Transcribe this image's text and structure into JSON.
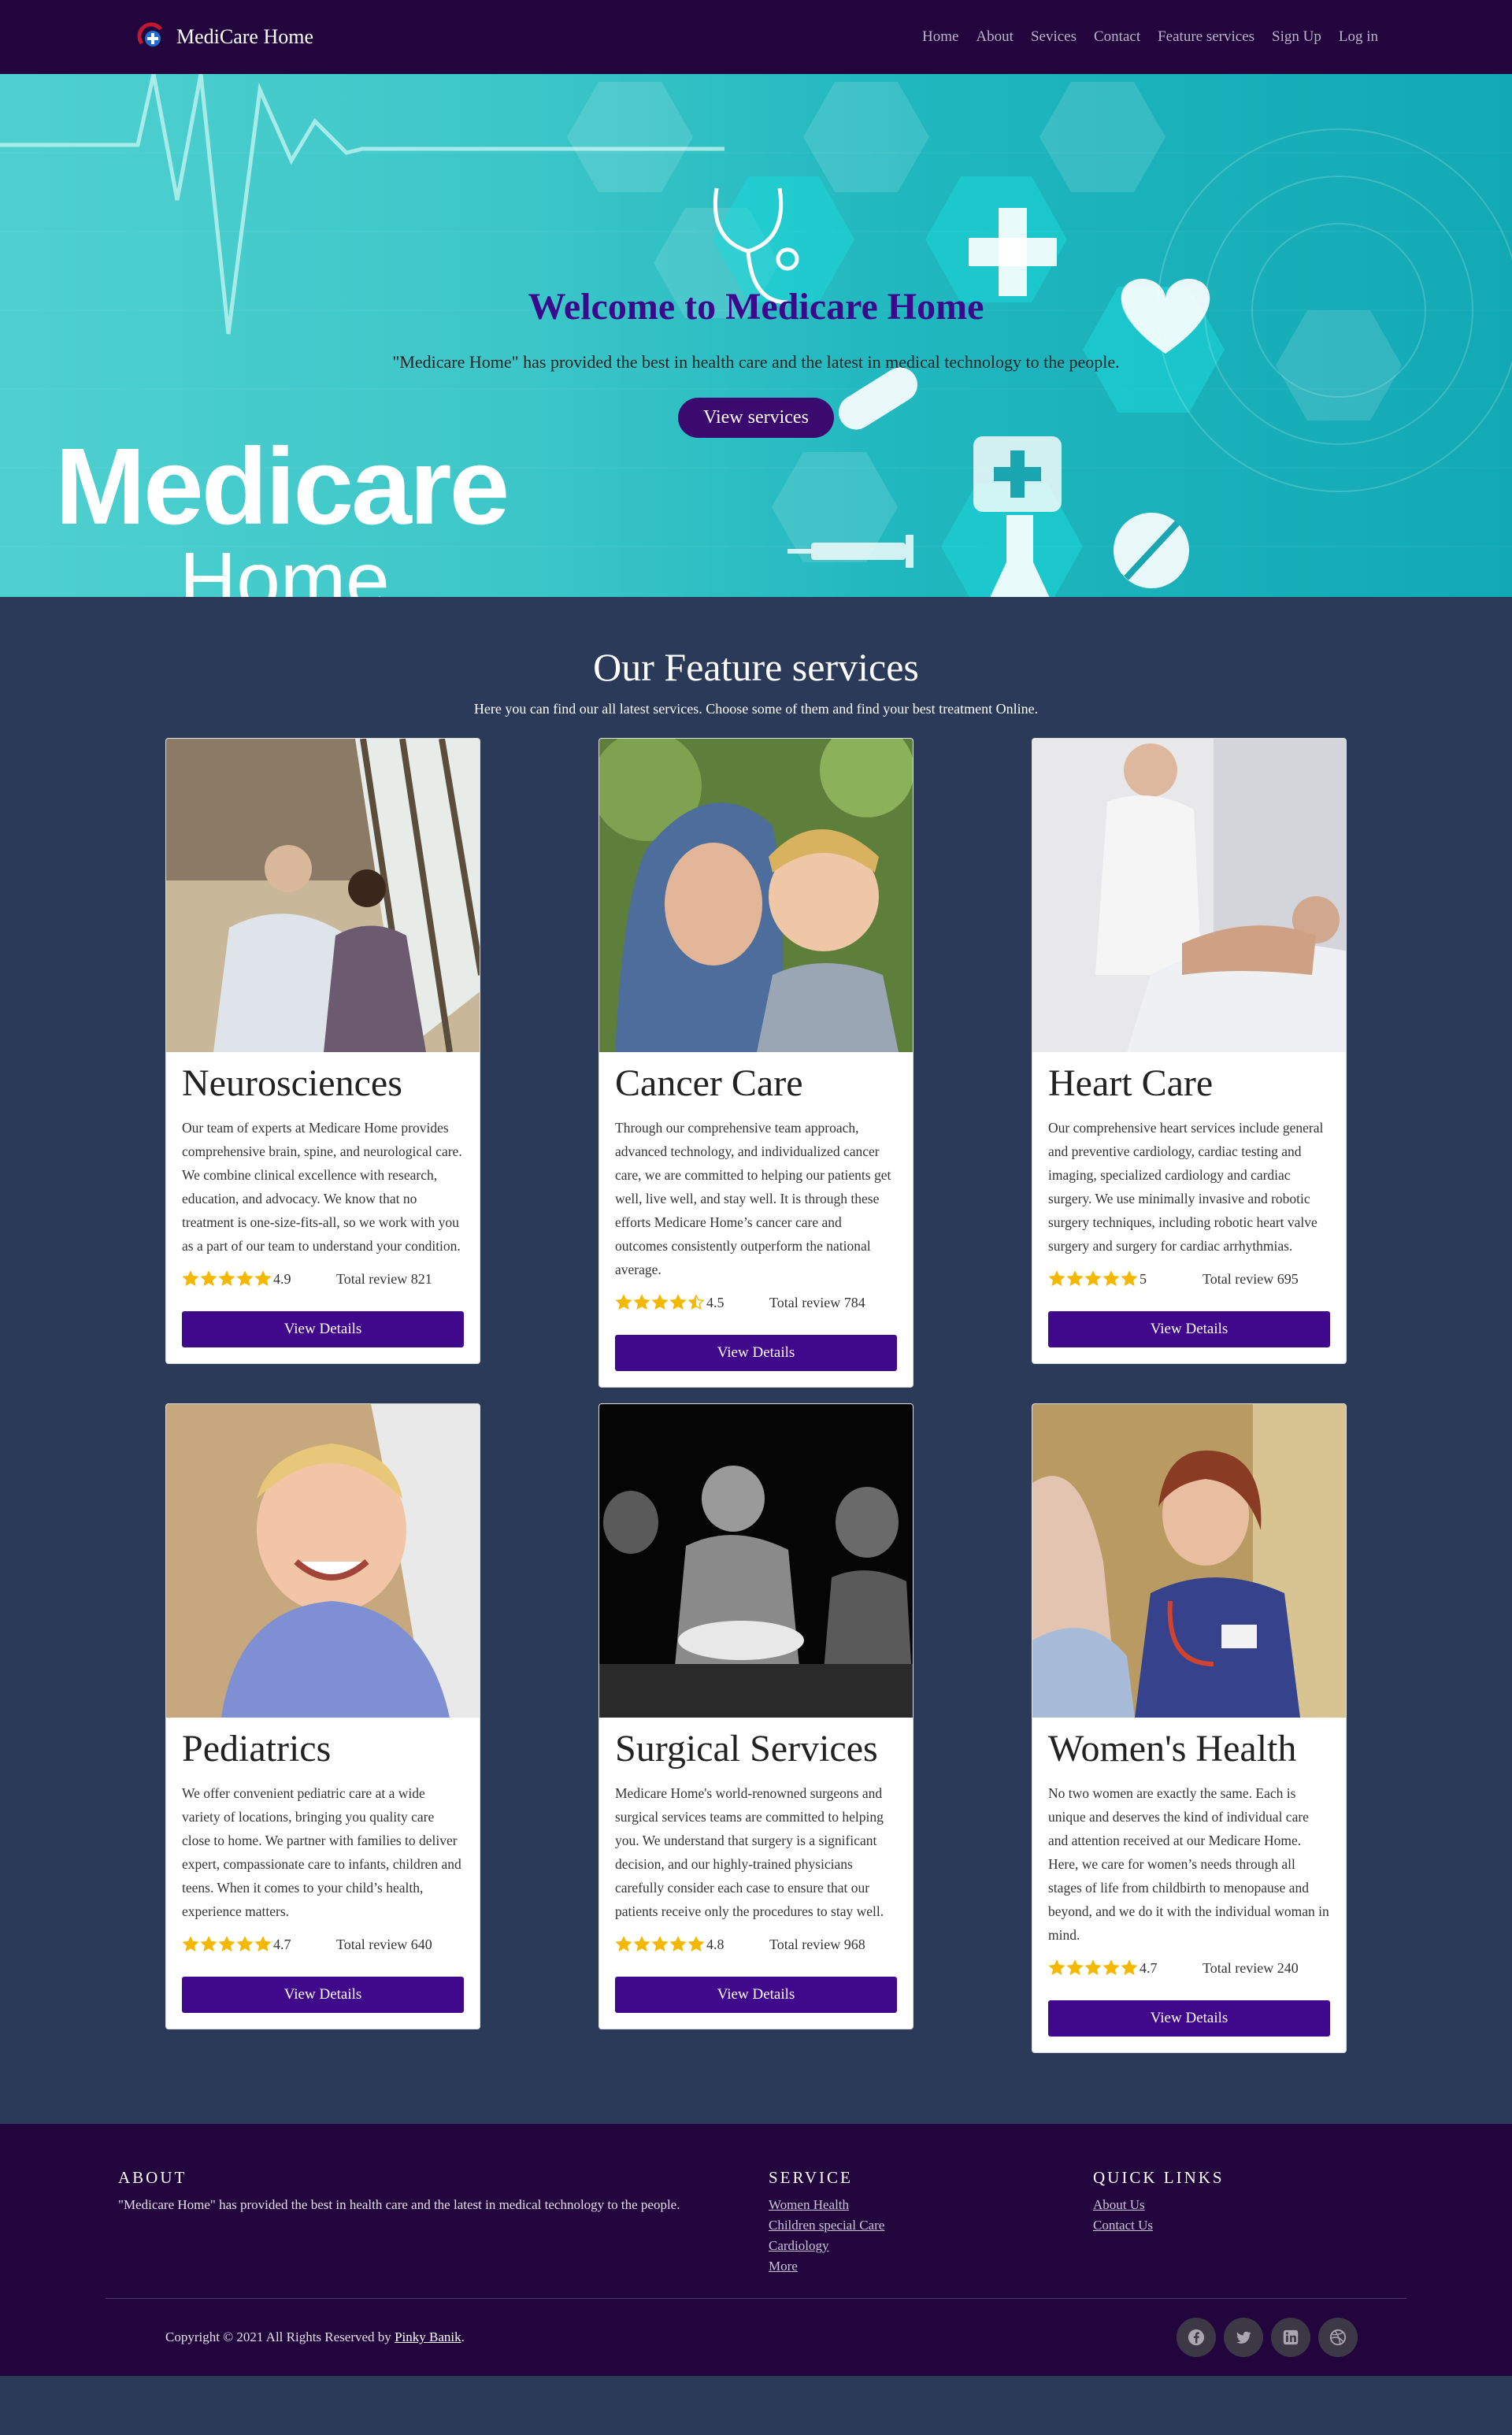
{
  "nav": {
    "brand": "MediCare Home",
    "links": [
      "Home",
      "About",
      "Sevices",
      "Contact",
      "Feature services",
      "Sign Up",
      "Log in"
    ]
  },
  "hero": {
    "title": "Welcome to Medicare Home",
    "subtitle": "\"Medicare Home\" has provided the best in health care and the latest in medical technology to the people.",
    "button": "View services",
    "logo_line1": "Medicare",
    "logo_line2": "Home"
  },
  "features": {
    "title": "Our Feature services",
    "subtitle": "Here you can find our all latest services. Choose some of them and find your best treatment Online.",
    "cards": [
      {
        "title": "Neurosciences",
        "text": "Our team of experts at Medicare Home provides comprehensive brain, spine, and neurological care. We combine clinical excellence with research, education, and advocacy. We know that no treatment is one-size-fits-all, so we work with you as a part of our team to understand your condition.",
        "rating": "4.9",
        "stars": 5,
        "reviews": "Total review 821",
        "button": "View Details"
      },
      {
        "title": "Cancer Care",
        "text": "Through our comprehensive team approach, advanced technology, and individualized cancer care, we are committed to helping our patients get well, live well, and stay well. It is through these efforts Medicare Home’s cancer care and outcomes consistently outperform the national average.",
        "rating": "4.5",
        "stars": 4.5,
        "reviews": "Total review 784",
        "button": "View Details"
      },
      {
        "title": "Heart Care",
        "text": "Our comprehensive heart services include general and preventive cardiology, cardiac testing and imaging, specialized cardiology and cardiac surgery. We use minimally invasive and robotic surgery techniques, including robotic heart valve surgery and surgery for cardiac arrhythmias.",
        "rating": "5",
        "stars": 5,
        "reviews": "Total review 695",
        "button": "View Details"
      },
      {
        "title": "Pediatrics",
        "text": "We offer convenient pediatric care at a wide variety of locations, bringing you quality care close to home. We partner with families to deliver expert, compassionate care to infants, children and teens. When it comes to your child’s health, experience matters.",
        "rating": "4.7",
        "stars": 5,
        "reviews": "Total review 640",
        "button": "View Details"
      },
      {
        "title": "Surgical Services",
        "text": "Medicare Home's world-renowned surgeons and surgical services teams are committed to helping you. We understand that surgery is a significant decision, and our highly-trained physicians carefully consider each case to ensure that our patients receive only the procedures to stay well.",
        "rating": "4.8",
        "stars": 5,
        "reviews": "Total review 968",
        "button": "View Details"
      },
      {
        "title": "Women's Health",
        "text": "No two women are exactly the same. Each is unique and deserves the kind of individual care and attention received at our Medicare Home. Here, we care for women’s needs through all stages of life from childbirth to menopause and beyond, and we do it with the individual woman in mind.",
        "rating": "4.7",
        "stars": 5,
        "reviews": "Total review 240",
        "button": "View Details"
      }
    ]
  },
  "footer": {
    "about_title": "ABOUT",
    "about_text": "\"Medicare Home\" has provided the best in health care and the latest in medical technology to the people.",
    "service_title": "SERVICE",
    "service_links": [
      "Women Health",
      "Children special Care",
      "Cardiology",
      "More"
    ],
    "quick_title": "QUICK LINKS",
    "quick_links": [
      "About Us",
      "Contact Us"
    ],
    "copyright_prefix": "Copyright © 2021 All Rights Reserved by",
    "author": "Pinky Banik",
    "copyright_suffix": ".",
    "socials": [
      "facebook-icon",
      "twitter-icon",
      "linkedin-icon",
      "dribbble-icon"
    ]
  },
  "colors": {
    "nav_bg": "#23053d",
    "accent": "#40088a",
    "hero_title": "#3b0a8c",
    "section_bg": "#2c3a5a",
    "star": "#f5b800"
  }
}
